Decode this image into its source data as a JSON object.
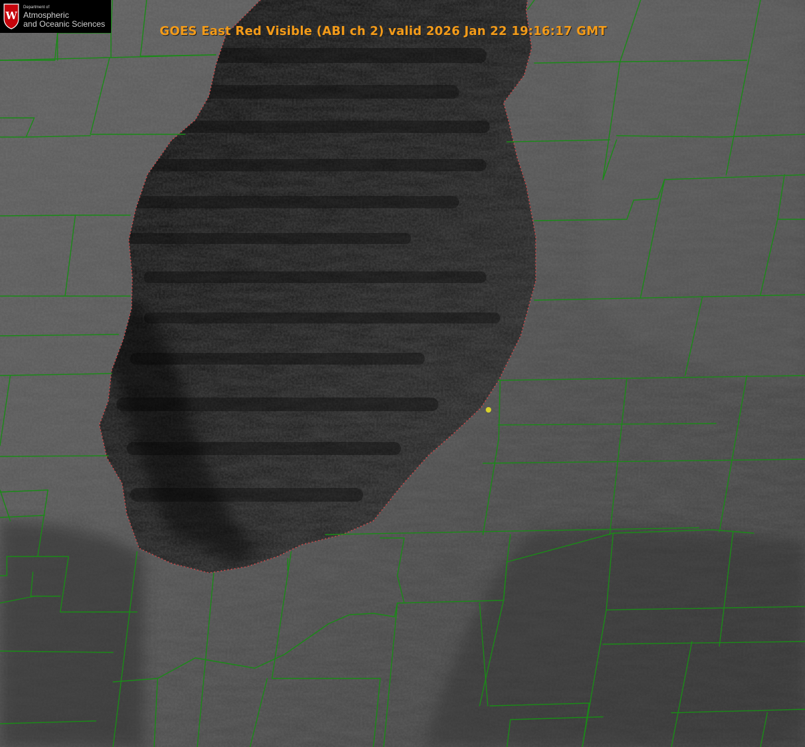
{
  "header": {
    "logo_department": "Department of",
    "logo_line_1": "Atmospheric",
    "logo_line_2": "and Oceanic Sciences",
    "logo_monogram": "W",
    "title": "GOES East Red Visible (ABI ch 2) valid 2026 Jan 22 19:16:17 GMT"
  },
  "colors": {
    "title": "#f39b19",
    "logo_background": "#000000",
    "logo_text": "#d2d2d2",
    "logo_crest": "#c5050c",
    "boundaries": "#1b8a18",
    "shoreline": "#d14a4a",
    "marker": "#d8d22a"
  },
  "map": {
    "boundary_color": "#1b8a18",
    "shoreline_color": "#d14a4a",
    "marker_color": "#d8d22a"
  }
}
